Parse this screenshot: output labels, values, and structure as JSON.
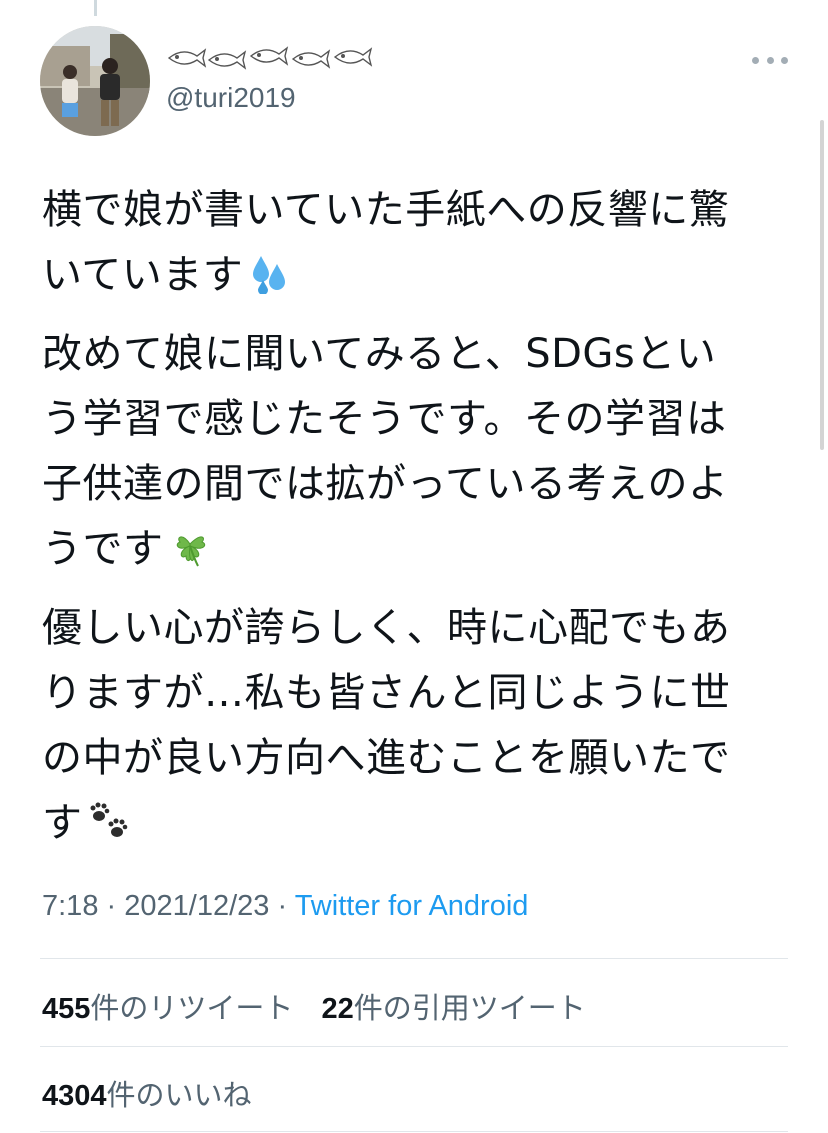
{
  "author": {
    "handle": "@turi2019",
    "display_name_icons": [
      "fish-icon",
      "fish-icon",
      "fish-icon",
      "fish-icon",
      "fish-icon"
    ]
  },
  "tweet": {
    "paragraphs": [
      {
        "text": "横で娘が書いていた手紙への反響に驚\nいています",
        "emoji": "sweat-droplets-icon"
      },
      {
        "text": "改めて娘に聞いてみると、SDGsとい\nう学習で感じたそうです。その学習は\n子供達の間では拡がっている考えのよ\nうです",
        "emoji": "four-leaf-clover-icon"
      },
      {
        "text": "優しい心が誇らしく、時に心配でもあ\nりますが…私も皆さんと同じように世\nの中が良い方向へ進むことを願いたで\nす",
        "emoji": "paw-prints-icon"
      }
    ],
    "time": "7:18",
    "date": "2021/12/23",
    "separator": "·",
    "source": "Twitter for Android"
  },
  "stats": {
    "retweets": {
      "count": "455",
      "label": "件のリツイート"
    },
    "quotes": {
      "count": "22",
      "label": "件の引用ツイート"
    },
    "likes": {
      "count": "4304",
      "label": "件のいいね"
    }
  },
  "colors": {
    "link": "#1d9bf0",
    "secondary_text": "#536471",
    "divider": "#e1e6ea"
  }
}
